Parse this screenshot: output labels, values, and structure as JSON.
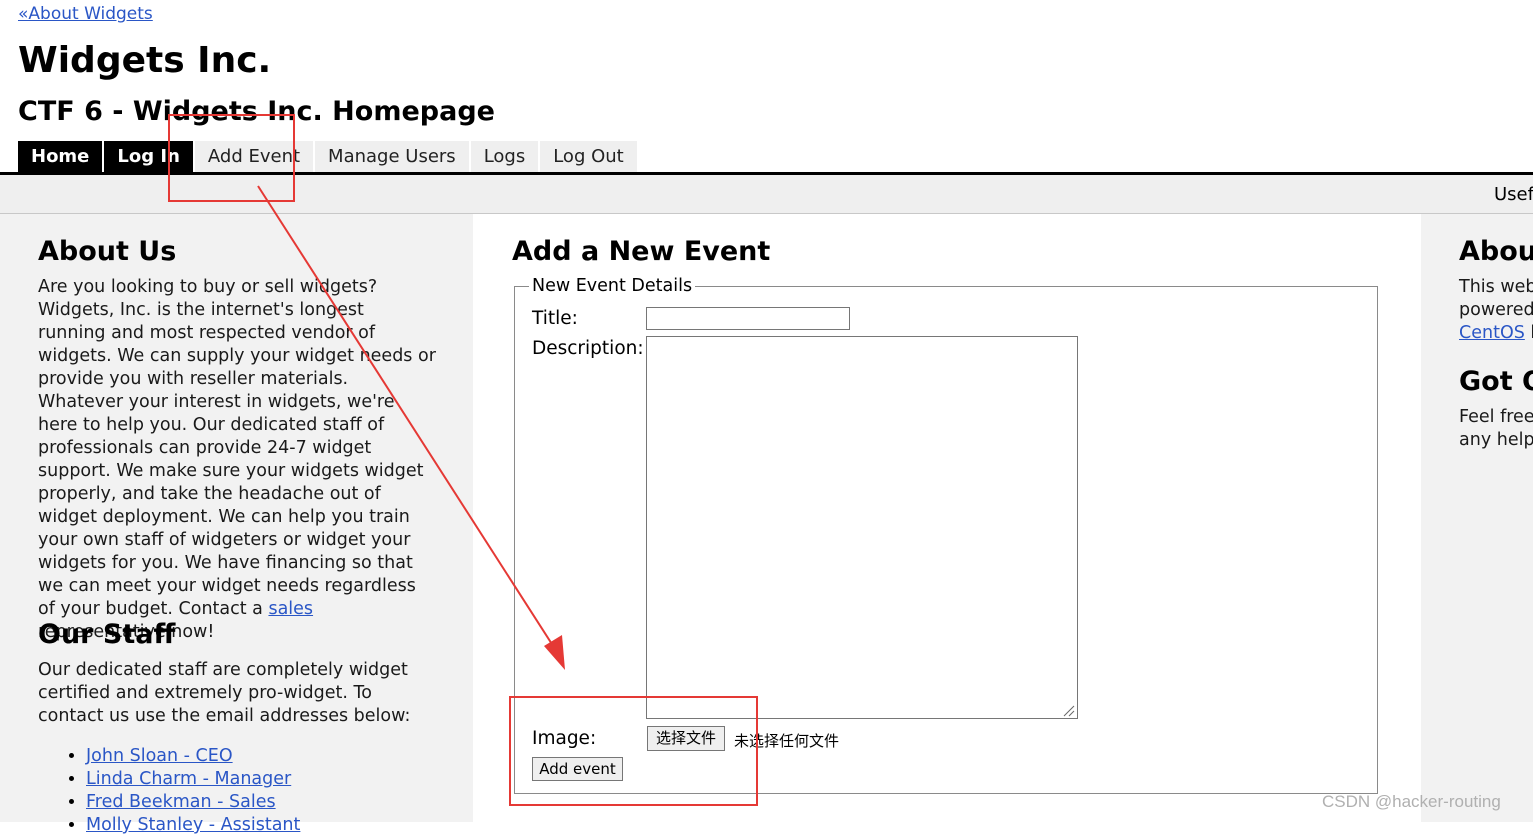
{
  "header": {
    "back_link": "«About Widgets",
    "site_title": "Widgets Inc.",
    "page_title": "CTF 6 - Widgets Inc. Homepage"
  },
  "nav": {
    "items": [
      {
        "label": "Home",
        "active": true
      },
      {
        "label": "Log In",
        "active": true
      },
      {
        "label": "Add Event",
        "active": false
      },
      {
        "label": "Manage Users",
        "active": false
      },
      {
        "label": "Logs",
        "active": false
      },
      {
        "label": "Log Out",
        "active": false
      }
    ]
  },
  "useful_bar": {
    "text": "Usef"
  },
  "left": {
    "about_heading": "About Us",
    "about_text_before": "Are you looking to buy or sell widgets? Widgets, Inc. is the internet's longest running and most respected vendor of widgets. We can supply your widget needs or provide you with reseller materials. Whatever your interest in widgets, we're here to help you. Our dedicated staff of professionals can provide 24-7 widget support. We make sure your widgets widget properly, and take the headache out of widget deployment. We can help you train your own staff of widgeters or widget your widgets for you. We have financing so that we can meet your widget needs regardless of your budget. Contact a ",
    "about_link": "sales",
    "about_text_after": " representative now!",
    "staff_heading": "Our Staff",
    "staff_text": "Our dedicated staff are completely widget certified and extremely pro-widget. To contact us use the email addresses below:",
    "staff": [
      "John Sloan - CEO",
      "Linda Charm - Manager",
      "Fred Beekman - Sales",
      "Molly Stanley - Assistant"
    ]
  },
  "form": {
    "heading": "Add a New Event",
    "legend": "New Event Details",
    "title_label": "Title:",
    "title_value": "",
    "description_label": "Description:",
    "description_value": "",
    "image_label": "Image:",
    "file_button": "选择文件",
    "file_status": "未选择任何文件",
    "submit_label": "Add event"
  },
  "right": {
    "about_heading": "About",
    "about_line1": "This web",
    "about_line2": "powered",
    "about_link": "CentOS",
    "about_link_after": " l",
    "got_heading": "Got Q",
    "got_line1": "Feel free",
    "got_line2": "any help."
  },
  "annotations": {
    "color": "#e53935"
  },
  "watermark": "CSDN @hacker-routing"
}
